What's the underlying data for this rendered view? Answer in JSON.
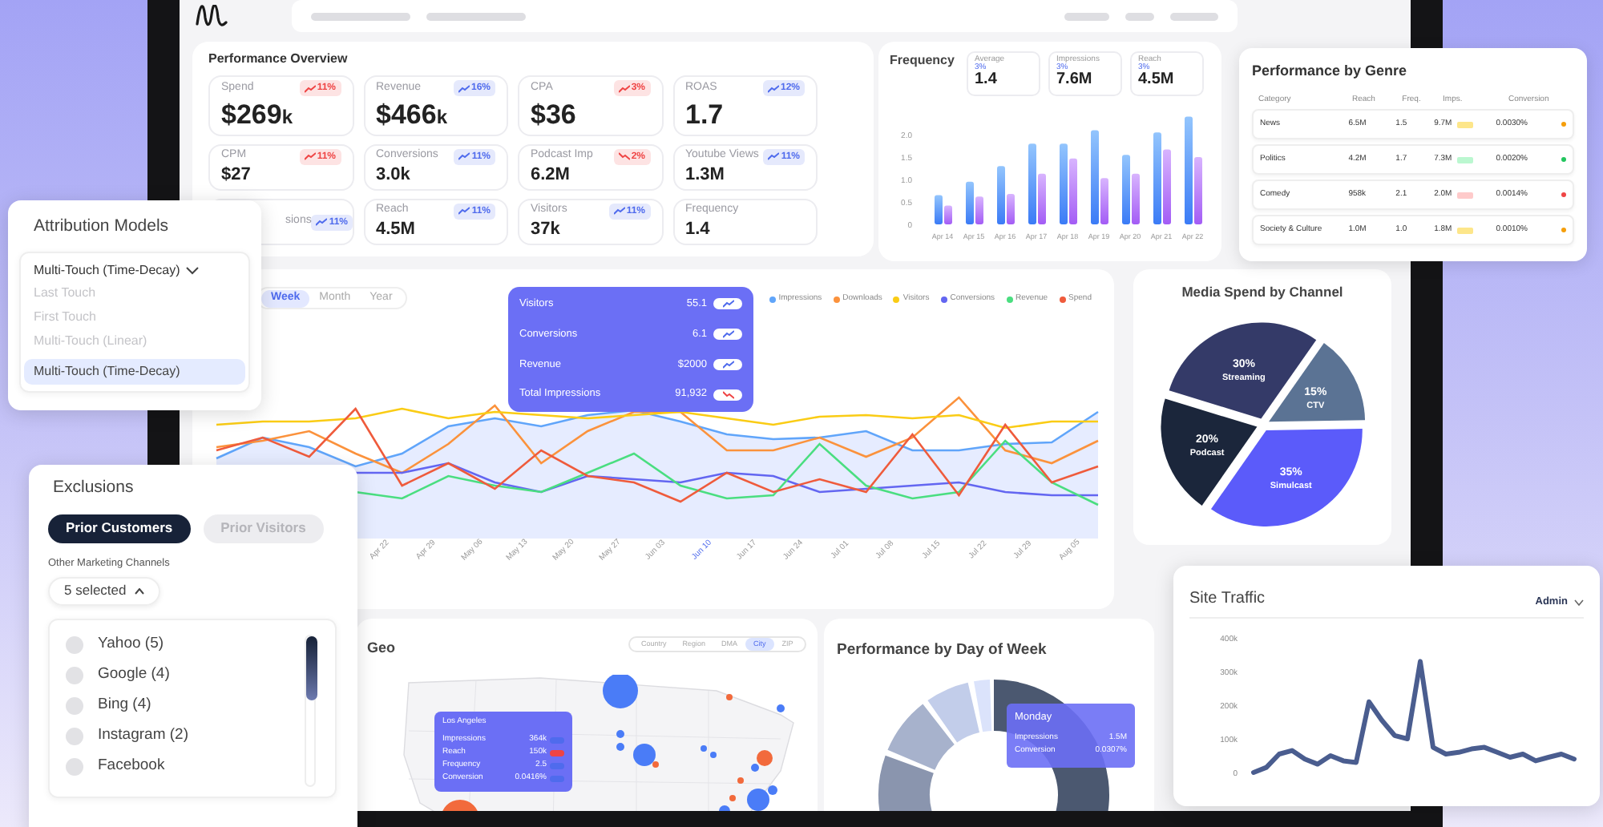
{
  "overview": {
    "title": "Performance Overview",
    "metrics": [
      {
        "kind": "large",
        "label": "Spend",
        "value": "$269",
        "unit": "k",
        "badge": {
          "text": "11%",
          "color": "#ef4444",
          "rising": true
        }
      },
      {
        "kind": "large",
        "label": "Revenue",
        "value": "$466",
        "unit": "k",
        "badge": {
          "text": "16%",
          "color": "#4f6bed",
          "rising": true
        }
      },
      {
        "kind": "large",
        "label": "CPA",
        "value": "$36",
        "badge": {
          "text": "3%",
          "color": "#ef4444",
          "rising": true
        }
      },
      {
        "kind": "large",
        "label": "ROAS",
        "value": "1.7",
        "badge": {
          "text": "12%",
          "color": "#4f6bed",
          "rising": true
        }
      },
      {
        "kind": "small",
        "label": "CPM",
        "value": "$27",
        "badge": {
          "text": "11%",
          "color": "#ef4444",
          "rising": true
        }
      },
      {
        "kind": "small",
        "label": "Conversions",
        "value": "3.0k",
        "badge": {
          "text": "11%",
          "color": "#4f6bed",
          "rising": true
        }
      },
      {
        "kind": "small",
        "label": "Podcast Imp",
        "value": "6.2M",
        "badge": {
          "text": "2%",
          "color": "#ef4444",
          "rising": false
        }
      },
      {
        "kind": "small",
        "label": "Youtube Views",
        "value": "1.3M",
        "badge": {
          "text": "11%",
          "color": "#4f6bed",
          "rising": true
        }
      },
      {
        "kind": "small",
        "label": "sions",
        "badge": {
          "text": "11%",
          "color": "#4f6bed",
          "rising": true
        }
      },
      {
        "kind": "small",
        "label": "Reach",
        "value": "4.5M",
        "badge": {
          "text": "11%",
          "color": "#4f6bed",
          "rising": true
        }
      },
      {
        "kind": "small",
        "label": "Visitors",
        "value": "37k",
        "badge": {
          "text": "11%",
          "color": "#4f6bed",
          "rising": true
        }
      },
      {
        "kind": "small",
        "label": "Frequency",
        "value": "1.4"
      }
    ]
  },
  "frequency": {
    "title": "Frequency",
    "stats": [
      {
        "label": "Average",
        "change": "3%",
        "value": "1.4"
      },
      {
        "label": "Impressions",
        "change": "3%",
        "value": "7.6M"
      },
      {
        "label": "Reach",
        "change": "3%",
        "value": "4.5M"
      }
    ],
    "chart_data": {
      "type": "bar",
      "categories": [
        "Apr 14",
        "Apr 15",
        "Apr 16",
        "Apr 17",
        "Apr 18",
        "Apr 19",
        "Apr 20",
        "Apr 21",
        "Apr 22"
      ],
      "series": [
        {
          "color": "#3b7bf6",
          "values": [
            0.65,
            0.95,
            1.3,
            1.8,
            1.8,
            2.1,
            1.55,
            2.05,
            2.4
          ]
        },
        {
          "color": "#a35cf5",
          "values": [
            0.42,
            0.62,
            0.68,
            1.13,
            1.47,
            1.03,
            1.13,
            1.67,
            1.5
          ]
        }
      ],
      "ylim": [
        0,
        2.5
      ],
      "yticks": [
        {
          "value": 0,
          "label": "0"
        },
        {
          "value": 0.5,
          "label": "0.5"
        },
        {
          "value": 1,
          "label": "1.0"
        },
        {
          "value": 1.5,
          "label": "1.5"
        },
        {
          "value": 2,
          "label": "2.0"
        }
      ]
    }
  },
  "genre": {
    "title": "Performance by Genre",
    "columns": [
      "Category",
      "Reach",
      "Freq.",
      "Imps.",
      "Conversion"
    ],
    "rows": [
      {
        "category": "News",
        "reach": "6.5M",
        "freq": "1.5",
        "imps": "9.7M",
        "badge": {
          "color": "#fde68a"
        },
        "conversion": "0.0030%",
        "color": "#f59e0b"
      },
      {
        "category": "Politics",
        "reach": "4.2M",
        "freq": "1.7",
        "imps": "7.3M",
        "badge": {
          "color": "#bbf7d0"
        },
        "conversion": "0.0020%",
        "color": "#22c55e"
      },
      {
        "category": "Comedy",
        "reach": "958k",
        "freq": "2.1",
        "imps": "2.0M",
        "badge": {
          "color": "#fecaca"
        },
        "conversion": "0.0014%",
        "color": "#ef4444"
      },
      {
        "category": "Society & Culture",
        "reach": "1.0M",
        "freq": "1.0",
        "imps": "1.8M",
        "badge": {
          "color": "#fde68a"
        },
        "conversion": "0.0010%",
        "color": "#f59e0b"
      }
    ]
  },
  "trends": {
    "tabs": [
      {
        "label": "Week",
        "selected": true
      },
      {
        "label": "Month",
        "selected": false
      },
      {
        "label": "Year",
        "selected": false
      }
    ],
    "legend": [
      {
        "label": "Impressions",
        "color": "#60a5fa"
      },
      {
        "label": "Downloads",
        "color": "#fb923c"
      },
      {
        "label": "Visitors",
        "color": "#facc15"
      },
      {
        "label": "Conversions",
        "color": "#6366f1"
      },
      {
        "label": "Revenue",
        "color": "#4ade80"
      },
      {
        "label": "Spend",
        "color": "#ef5b3c"
      }
    ],
    "tooltip": {
      "rows": [
        {
          "label": "Visitors",
          "value": "55.1",
          "color": "#4f6bed",
          "rising": true
        },
        {
          "label": "Conversions",
          "value": "6.1",
          "color": "#4f6bed",
          "rising": true
        },
        {
          "label": "Revenue",
          "value": "$2000",
          "color": "#4f6bed",
          "rising": true
        },
        {
          "label": "Total Impressions",
          "value": "91,932",
          "color": "#ef4444",
          "rising": false
        }
      ]
    },
    "x_labels": [
      {
        "label": "Apr 22",
        "selected": false
      },
      {
        "label": "Apr 29",
        "selected": false
      },
      {
        "label": "May 06",
        "selected": false
      },
      {
        "label": "May 13",
        "selected": false
      },
      {
        "label": "May 20",
        "selected": false
      },
      {
        "label": "May 27",
        "selected": false
      },
      {
        "label": "Jun 03",
        "selected": false
      },
      {
        "label": "Jun 10",
        "selected": true
      },
      {
        "label": "Jun 17",
        "selected": false
      },
      {
        "label": "Jun 24",
        "selected": false
      },
      {
        "label": "Jul 01",
        "selected": false
      },
      {
        "label": "Jul 08",
        "selected": false
      },
      {
        "label": "Jul 15",
        "selected": false
      },
      {
        "label": "Jul 22",
        "selected": false
      },
      {
        "label": "Jul 29",
        "selected": false
      },
      {
        "label": "Aug 05",
        "selected": false
      }
    ]
  },
  "media_spend": {
    "title": "Media Spend by Channel",
    "chart_data": {
      "type": "pie",
      "categories": [
        "Streaming",
        "CTV",
        "Simulcast",
        "Podcast"
      ],
      "values": [
        30,
        15,
        35,
        20
      ],
      "value_labels": [
        "30%",
        "15%",
        "35%",
        "20%"
      ]
    }
  },
  "attribution": {
    "title": "Attribution Models",
    "value": "Multi-Touch (Time-Decay)",
    "expanded": true,
    "options": [
      {
        "label": "Last Touch",
        "selected": false
      },
      {
        "label": "First Touch",
        "selected": false
      },
      {
        "label": "Multi-Touch (Linear)",
        "selected": false
      },
      {
        "label": "Multi-Touch (Time-Decay)",
        "selected": true
      }
    ]
  },
  "exclusions": {
    "title": "Exclusions",
    "toggles": [
      {
        "label": "Prior Customers",
        "selected": true
      },
      {
        "label": "Prior Visitors",
        "selected": false
      }
    ],
    "channels_label": "Other Marketing Channels",
    "dropdown": {
      "value": "5 selected",
      "expanded": true
    },
    "channels": [
      {
        "label": "Yahoo (5)",
        "checked": false
      },
      {
        "label": "Google (4)",
        "checked": false
      },
      {
        "label": "Bing (4)",
        "checked": false
      },
      {
        "label": "Instagram (2)",
        "checked": false
      },
      {
        "label": "Facebook",
        "checked": false
      }
    ]
  },
  "geo": {
    "title": "Geo",
    "tabs": [
      {
        "label": "Country",
        "selected": false
      },
      {
        "label": "Region",
        "selected": false
      },
      {
        "label": "DMA",
        "selected": false
      },
      {
        "label": "City",
        "selected": true
      },
      {
        "label": "ZIP",
        "selected": false
      }
    ],
    "tooltip": {
      "title": "Los Angeles",
      "rows": [
        {
          "label": "Impressions",
          "value": "364k",
          "color": "#4f6bed"
        },
        {
          "label": "Reach",
          "value": "150k",
          "color": "#ef4444"
        },
        {
          "label": "Frequency",
          "value": "2.5",
          "color": "#4f6bed"
        },
        {
          "label": "Conversion",
          "value": "0.0416%",
          "color": "#4f6bed"
        }
      ]
    }
  },
  "day_of_week": {
    "title": "Performance by Day of Week",
    "tooltip": {
      "title": "Monday",
      "rows": [
        {
          "label": "Impressions",
          "value": "1.5M"
        },
        {
          "label": "Conversion",
          "value": "0.0307%"
        }
      ]
    }
  },
  "site_traffic": {
    "title": "Site Traffic",
    "filter": {
      "value": "Admin"
    },
    "chart_data": {
      "type": "line",
      "categories": [
        null,
        null,
        null,
        null,
        null,
        null,
        null,
        null,
        null,
        null,
        null,
        null,
        null,
        null,
        null,
        null,
        null,
        null,
        null,
        null,
        null,
        null,
        null,
        null,
        null,
        null
      ],
      "series": [
        {
          "color": "#4a5d8f",
          "values": [
            0,
            15,
            55,
            65,
            40,
            25,
            50,
            35,
            30,
            210,
            155,
            110,
            100,
            330,
            75,
            55,
            60,
            70,
            75,
            60,
            45,
            55,
            35,
            45,
            55,
            40
          ]
        }
      ],
      "ylim": [
        0,
        400
      ],
      "yticks": [
        {
          "value": 0,
          "label": "0"
        },
        {
          "value": 100,
          "label": "100k"
        },
        {
          "value": 200,
          "label": "200k"
        },
        {
          "value": 300,
          "label": "300k"
        },
        {
          "value": 400,
          "label": "400k"
        }
      ]
    }
  }
}
